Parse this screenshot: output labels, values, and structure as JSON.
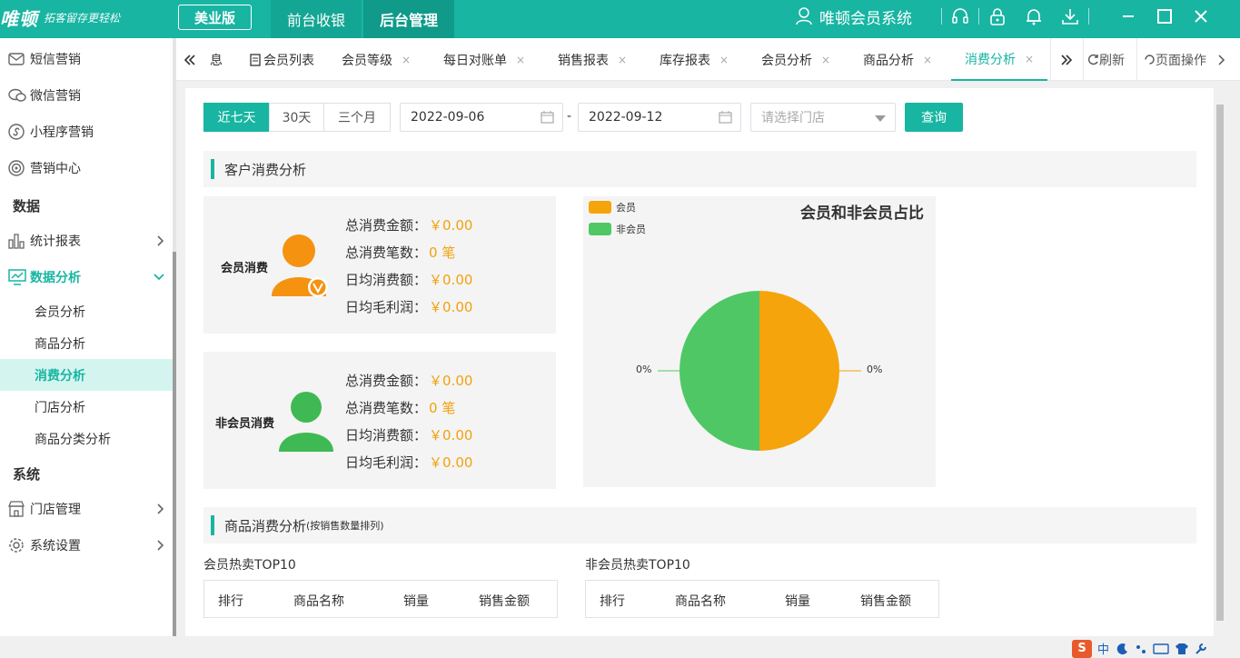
{
  "header": {
    "logo": "唯顿",
    "slogan": "拓客留存更轻松",
    "edition": "美业版",
    "nav_tabs": [
      "前台收银",
      "后台管理"
    ],
    "system_name": "唯顿会员系统"
  },
  "sidebar": {
    "items": [
      {
        "label": "短信营销",
        "icon": "envelope-icon"
      },
      {
        "label": "微信营销",
        "icon": "chat-icon"
      },
      {
        "label": "小程序营销",
        "icon": "miniapp-icon"
      },
      {
        "label": "营销中心",
        "icon": "target-icon"
      }
    ],
    "section_data": "数据",
    "stats_report": "统计报表",
    "data_analysis": "数据分析",
    "sub_items": [
      "会员分析",
      "商品分析",
      "消费分析",
      "门店分析",
      "商品分类分析"
    ],
    "section_system": "系统",
    "store_mgmt": "门店管理",
    "system_settings": "系统设置"
  },
  "tabs": {
    "partial": "息",
    "items": [
      "会员列表",
      "会员等级",
      "每日对账单",
      "销售报表",
      "库存报表",
      "会员分析",
      "商品分析",
      "消费分析"
    ],
    "close": "×",
    "refresh": "刷新",
    "page_ops": "页面操作"
  },
  "filters": {
    "ranges": [
      "近七天",
      "30天",
      "三个月"
    ],
    "start_date": "2022-09-06",
    "dash": "-",
    "end_date": "2022-09-12",
    "store_placeholder": "请选择门店",
    "query": "查询"
  },
  "customer_section": {
    "title": "客户消费分析",
    "member": {
      "label": "会员消费",
      "rows": [
        {
          "k": "总消费金额：",
          "v": "￥0.00"
        },
        {
          "k": "总消费笔数：",
          "v": "0 笔"
        },
        {
          "k": "日均消费额：",
          "v": "￥0.00"
        },
        {
          "k": "日均毛利润：",
          "v": "￥0.00"
        }
      ]
    },
    "nonmember": {
      "label": "非会员消费",
      "rows": [
        {
          "k": "总消费金额：",
          "v": "￥0.00"
        },
        {
          "k": "总消费笔数：",
          "v": "0 笔"
        },
        {
          "k": "日均消费额：",
          "v": "￥0.00"
        },
        {
          "k": "日均毛利润：",
          "v": "￥0.00"
        }
      ]
    }
  },
  "chart_data": {
    "type": "pie",
    "title": "会员和非会员占比",
    "legend": "top-left",
    "slices": [
      {
        "name": "会员",
        "value": 50,
        "label": "0%",
        "color": "#f5a40c"
      },
      {
        "name": "非会员",
        "value": 50,
        "label": "0%",
        "color": "#4fc765"
      }
    ]
  },
  "product_section": {
    "title": "商品消费分析",
    "subtitle": "(按销售数量排列)",
    "member_top": "会员热卖TOP10",
    "nonmember_top": "非会员热卖TOP10",
    "columns": [
      "排行",
      "商品名称",
      "销量",
      "销售金额"
    ]
  },
  "ime": {
    "logo": "S",
    "lang": "中"
  },
  "colors": {
    "brand": "#17b5a2",
    "value": "#f2a10c",
    "member": "#f5920f",
    "nonmember": "#3fb954"
  }
}
